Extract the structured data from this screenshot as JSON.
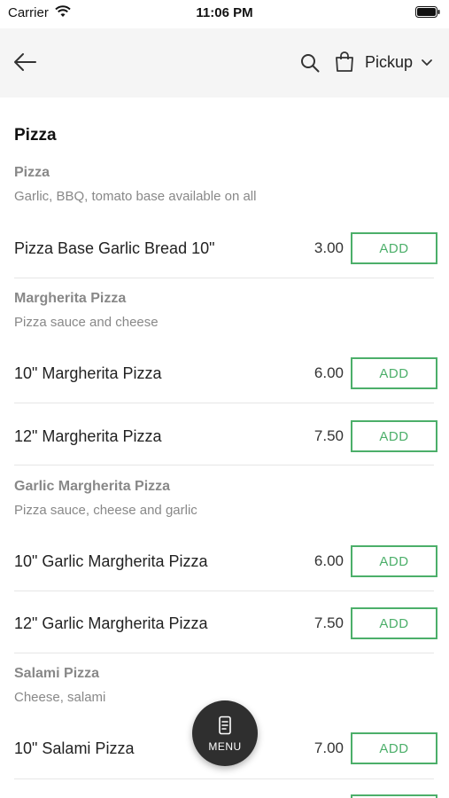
{
  "status_bar": {
    "carrier": "Carrier",
    "time": "11:06 PM"
  },
  "nav": {
    "pickup_label": "Pickup"
  },
  "page_title": "Pizza",
  "sections": [
    {
      "title": "Pizza",
      "description": "Garlic, BBQ, tomato base available on all",
      "items": [
        {
          "name": "Pizza Base Garlic Bread 10\"",
          "price": "3.00",
          "add_label": "ADD"
        }
      ]
    },
    {
      "title": "Margherita Pizza",
      "description": "Pizza sauce and cheese",
      "items": [
        {
          "name": "10\" Margherita Pizza",
          "price": "6.00",
          "add_label": "ADD"
        },
        {
          "name": "12\" Margherita Pizza",
          "price": "7.50",
          "add_label": "ADD"
        }
      ]
    },
    {
      "title": "Garlic Margherita Pizza",
      "description": "Pizza sauce, cheese and garlic",
      "items": [
        {
          "name": "10\" Garlic Margherita Pizza",
          "price": "6.00",
          "add_label": "ADD"
        },
        {
          "name": "12\" Garlic Margherita Pizza",
          "price": "7.50",
          "add_label": "ADD"
        }
      ]
    },
    {
      "title": "Salami Pizza",
      "description": "Cheese, salami",
      "items": [
        {
          "name": "10\" Salami Pizza",
          "price": "7.00",
          "add_label": "ADD"
        }
      ]
    }
  ],
  "fab": {
    "label": "MENU"
  },
  "colors": {
    "accent": "#4caf6a",
    "fab_bg": "#2f2f2f",
    "nav_bg": "#f5f5f5"
  }
}
